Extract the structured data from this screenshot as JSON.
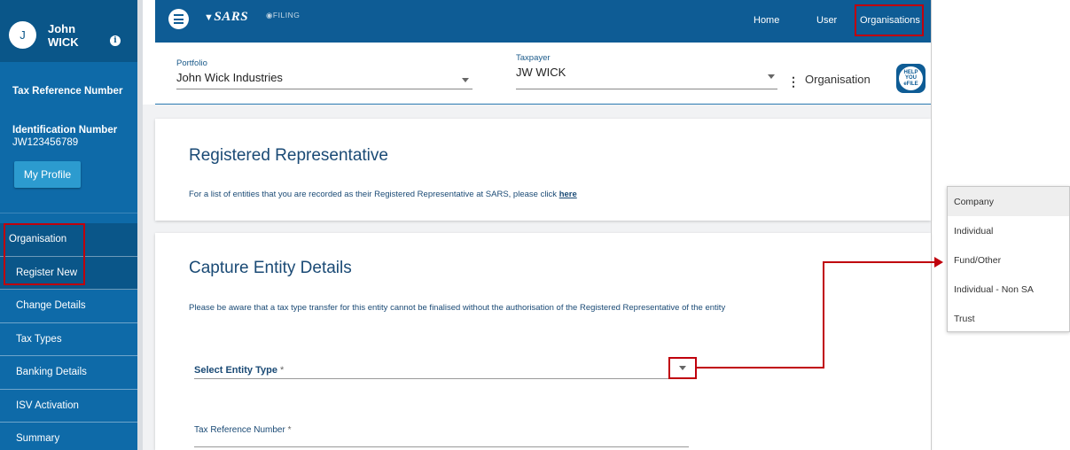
{
  "user": {
    "initial": "J",
    "first_name": "John",
    "last_name": "WICK",
    "tax_reference_label": "Tax Reference Number",
    "identification_label": "Identification Number",
    "identification_value": "JW123456789",
    "profile_button": "My Profile"
  },
  "sidebar": {
    "items": [
      {
        "label": "Organisation"
      },
      {
        "label": "Register New"
      },
      {
        "label": "Change Details"
      },
      {
        "label": "Tax Types"
      },
      {
        "label": "Banking Details"
      },
      {
        "label": "ISV Activation"
      },
      {
        "label": "Summary"
      }
    ]
  },
  "topbar": {
    "logo_text": "SARS",
    "efiling_text": "FILING",
    "links": {
      "home": "Home",
      "user": "User",
      "organisations": "Organisations"
    }
  },
  "selector": {
    "portfolio_label": "Portfolio",
    "portfolio_value": "John Wick Industries",
    "taxpayer_label": "Taxpayer",
    "taxpayer_value": "JW WICK",
    "organisation_label": "Organisation",
    "help_icon_lines": [
      "HELP",
      "YOU",
      "eFILE"
    ]
  },
  "registered_rep": {
    "title": "Registered Representative",
    "text": "For a list of entities that you are recorded as their Registered Representative at SARS, please click",
    "link": "here"
  },
  "capture": {
    "title": "Capture Entity Details",
    "notice": "Please be aware that a tax type transfer for this entity cannot be finalised without the authorisation of the Registered Representative of the entity",
    "entity_type_label": "Select Entity Type",
    "tax_ref_label": "Tax Reference Number",
    "required_marker": "*"
  },
  "entity_dropdown": {
    "options": [
      "Company",
      "Individual",
      "Fund/Other",
      "Individual - Non SA",
      "Trust"
    ],
    "selected": "Company"
  },
  "colors": {
    "sidebar": "#0e6aa8",
    "sidebar_dark": "#0a5689",
    "topbar": "#0e5c95",
    "highlight": "#c0000c",
    "title_text": "#1a4a75"
  }
}
